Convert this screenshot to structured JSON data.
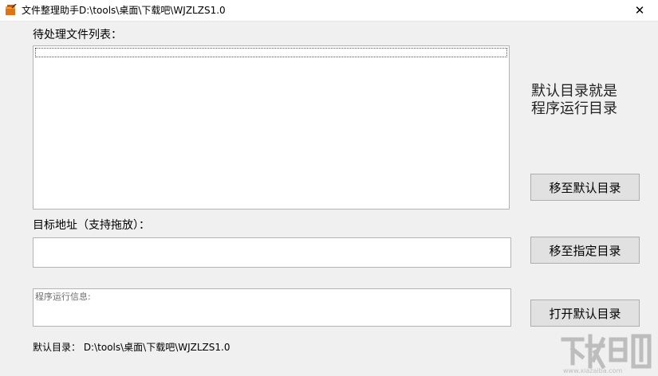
{
  "window": {
    "title": "文件整理助手D:\\tools\\桌面\\下载吧\\WJZLZS1.0",
    "close_glyph": "✕"
  },
  "file_list": {
    "label": "待处理文件列表："
  },
  "target": {
    "label": "目标地址（支持拖放）：",
    "value": ""
  },
  "info": {
    "placeholder": "程序运行信息:"
  },
  "note": {
    "line1": "默认目录就是",
    "line2": "程序运行目录"
  },
  "buttons": {
    "move_default": "移至默认目录",
    "move_specified": "移至指定目录",
    "open_default": "打开默认目录"
  },
  "footer": {
    "text": "默认目录： D:\\tools\\桌面\\下载吧\\WJZLZS1.0"
  },
  "colors": {
    "window_bg": "#f0f0f0",
    "button_bg": "#e1e1e1",
    "border": "#b4b4b4"
  }
}
